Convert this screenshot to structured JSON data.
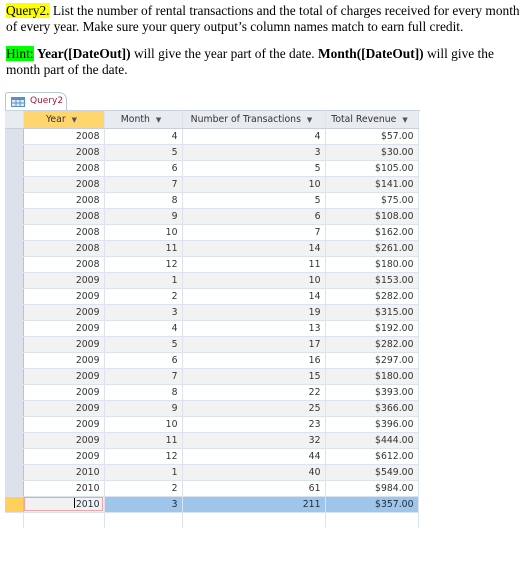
{
  "instructions": {
    "query_label": "Query2.",
    "query_text": " List the number of rental transactions and the total of charges received for every month of every year.  Make sure your query output’s column names match to earn full credit.",
    "hint_label": "Hint:",
    "hint_part1_bold": "Year([DateOut])",
    "hint_part2": " will give the year part of the date. ",
    "hint_part3_bold": "Month([DateOut])",
    "hint_part4": " will give the month part of the date."
  },
  "colors": {
    "query_highlight": "#ffff00",
    "hint_highlight": "#00ff00",
    "tab_label": "#a0183c",
    "selected_row": "#9fc6ea",
    "active_header": "#ffd66e"
  },
  "datasheet": {
    "tab_label": "Query2",
    "tab_icon": "query-icon",
    "columns": [
      {
        "label": "Year"
      },
      {
        "label": "Month"
      },
      {
        "label": "Number of Transactions"
      },
      {
        "label": "Total Revenue"
      }
    ],
    "rows": [
      {
        "year": "2008",
        "month": "4",
        "transactions": "4",
        "revenue": "$57.00"
      },
      {
        "year": "2008",
        "month": "5",
        "transactions": "3",
        "revenue": "$30.00"
      },
      {
        "year": "2008",
        "month": "6",
        "transactions": "5",
        "revenue": "$105.00"
      },
      {
        "year": "2008",
        "month": "7",
        "transactions": "10",
        "revenue": "$141.00"
      },
      {
        "year": "2008",
        "month": "8",
        "transactions": "5",
        "revenue": "$75.00"
      },
      {
        "year": "2008",
        "month": "9",
        "transactions": "6",
        "revenue": "$108.00"
      },
      {
        "year": "2008",
        "month": "10",
        "transactions": "7",
        "revenue": "$162.00"
      },
      {
        "year": "2008",
        "month": "11",
        "transactions": "14",
        "revenue": "$261.00"
      },
      {
        "year": "2008",
        "month": "12",
        "transactions": "11",
        "revenue": "$180.00"
      },
      {
        "year": "2009",
        "month": "1",
        "transactions": "10",
        "revenue": "$153.00"
      },
      {
        "year": "2009",
        "month": "2",
        "transactions": "14",
        "revenue": "$282.00"
      },
      {
        "year": "2009",
        "month": "3",
        "transactions": "19",
        "revenue": "$315.00"
      },
      {
        "year": "2009",
        "month": "4",
        "transactions": "13",
        "revenue": "$192.00"
      },
      {
        "year": "2009",
        "month": "5",
        "transactions": "17",
        "revenue": "$282.00"
      },
      {
        "year": "2009",
        "month": "6",
        "transactions": "16",
        "revenue": "$297.00"
      },
      {
        "year": "2009",
        "month": "7",
        "transactions": "15",
        "revenue": "$180.00"
      },
      {
        "year": "2009",
        "month": "8",
        "transactions": "22",
        "revenue": "$393.00"
      },
      {
        "year": "2009",
        "month": "9",
        "transactions": "25",
        "revenue": "$366.00"
      },
      {
        "year": "2009",
        "month": "10",
        "transactions": "23",
        "revenue": "$396.00"
      },
      {
        "year": "2009",
        "month": "11",
        "transactions": "32",
        "revenue": "$444.00"
      },
      {
        "year": "2009",
        "month": "12",
        "transactions": "44",
        "revenue": "$612.00"
      },
      {
        "year": "2010",
        "month": "1",
        "transactions": "40",
        "revenue": "$549.00"
      },
      {
        "year": "2010",
        "month": "2",
        "transactions": "61",
        "revenue": "$984.00"
      },
      {
        "year": "2010",
        "month": "3",
        "transactions": "211",
        "revenue": "$357.00"
      }
    ],
    "current_row_index": 23
  }
}
